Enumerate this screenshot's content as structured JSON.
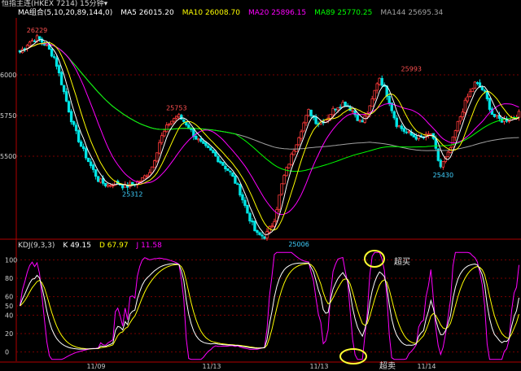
{
  "header": {
    "title": "恒指主连(HKEX 7214)  15分钟▾"
  },
  "colors": {
    "up": "#ff3b3b",
    "down": "#00e5e5",
    "ma5": "#ffffff",
    "ma10": "#ffff00",
    "ma20": "#ff00ff",
    "ma89": "#00ff00",
    "ma144": "#a0a0a0",
    "k": "#ffffff",
    "d": "#ffff00",
    "j": "#ff00ff",
    "grid": "#7a0000",
    "highlight": "#ffff33"
  },
  "chart_data": [
    {
      "type": "candlestick",
      "legend": [
        {
          "name": "MA组合(5,10,20,89,144,0)",
          "value": "",
          "color": "#ffffff"
        },
        {
          "name": "MA5",
          "value": "26015.20",
          "color": "#ffffff"
        },
        {
          "name": "MA10",
          "value": "26008.70",
          "color": "#ffff00"
        },
        {
          "name": "MA20",
          "value": "25896.15",
          "color": "#ff00ff"
        },
        {
          "name": "MA89",
          "value": "25770.25",
          "color": "#00ff00"
        },
        {
          "name": "MA144",
          "value": "25695.34",
          "color": "#a0a0a0"
        }
      ],
      "y_ticks": [
        26000,
        25750,
        25500
      ],
      "ylim": [
        25000,
        26350
      ],
      "annotations": [
        {
          "text": "26229",
          "value": 26229
        },
        {
          "text": "25753",
          "value": 25753
        },
        {
          "text": "25312",
          "value": 25312
        },
        {
          "text": "25006",
          "value": 25006
        },
        {
          "text": "25993",
          "value": 25993
        },
        {
          "text": "25430",
          "value": 25430
        }
      ],
      "anchors": [
        26140,
        26200,
        26229,
        26180,
        26100,
        25900,
        25700,
        25560,
        25450,
        25350,
        25320,
        25340,
        25312,
        25330,
        25360,
        25420,
        25600,
        25700,
        25753,
        25700,
        25620,
        25560,
        25520,
        25460,
        25400,
        25300,
        25150,
        25020,
        25006,
        25100,
        25350,
        25500,
        25650,
        25780,
        25700,
        25730,
        25800,
        25830,
        25780,
        25700,
        25800,
        25993,
        25870,
        25700,
        25650,
        25620,
        25610,
        25640,
        25430,
        25520,
        25700,
        25850,
        25950,
        25900,
        25750,
        25720,
        25730,
        25760
      ],
      "x_labels": [
        "11/09",
        "11/13",
        "11/13",
        "11/14"
      ]
    },
    {
      "type": "line",
      "title": "KDJ(9,3,3)",
      "legend": [
        {
          "name": "K",
          "value": "49.15",
          "color": "#ffffff"
        },
        {
          "name": "D",
          "value": "67.97",
          "color": "#ffff00"
        },
        {
          "name": "J",
          "value": "11.58",
          "color": "#ff00ff"
        }
      ],
      "y_ticks": [
        100,
        80,
        60,
        50,
        40,
        20,
        0
      ],
      "ylim": [
        -10,
        110
      ],
      "annotations": [
        {
          "text": "超买"
        },
        {
          "text": "超卖"
        }
      ]
    }
  ]
}
